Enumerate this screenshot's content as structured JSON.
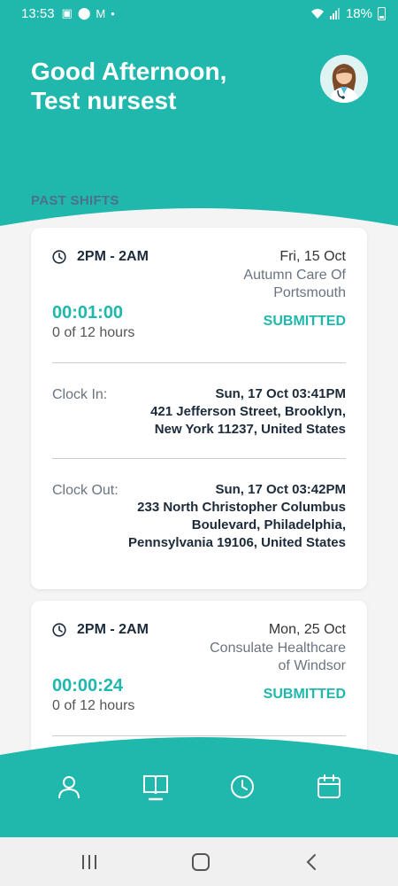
{
  "status_bar": {
    "time": "13:53",
    "battery": "18%"
  },
  "header": {
    "greeting_line1": "Good Afternoon,",
    "greeting_line2": "Test nursest"
  },
  "section_title": "PAST SHIFTS",
  "shifts": [
    {
      "time": "2PM - 2AM",
      "date": "Fri, 15 Oct",
      "facility": "Autumn Care Of Portsmouth",
      "duration": "00:01:00",
      "hours": "0 of  12 hours",
      "status": "SUBMITTED",
      "clock_in_label": "Clock In:",
      "clock_in_time": "Sun, 17 Oct 03:41PM",
      "clock_in_address": "421 Jefferson Street, Brooklyn, New York 11237, United States",
      "clock_out_label": "Clock Out:",
      "clock_out_time": "Sun, 17 Oct 03:42PM",
      "clock_out_address": "233 North Christopher Columbus Boulevard, Philadelphia, Pennsylvania 19106, United States"
    },
    {
      "time": "2PM - 2AM",
      "date": "Mon, 25 Oct",
      "facility": "Consulate Healthcare of Windsor",
      "duration": "00:00:24",
      "hours": "0 of  12 hours",
      "status": "SUBMITTED"
    }
  ],
  "colors": {
    "accent": "#20b8ad",
    "heading": "#1c2a3a",
    "section": "#4e6f8a"
  },
  "bottom_nav": [
    "profile-icon",
    "book-icon",
    "clock-icon",
    "calendar-icon"
  ],
  "android_nav": [
    "recents-icon",
    "home-icon",
    "back-icon"
  ]
}
